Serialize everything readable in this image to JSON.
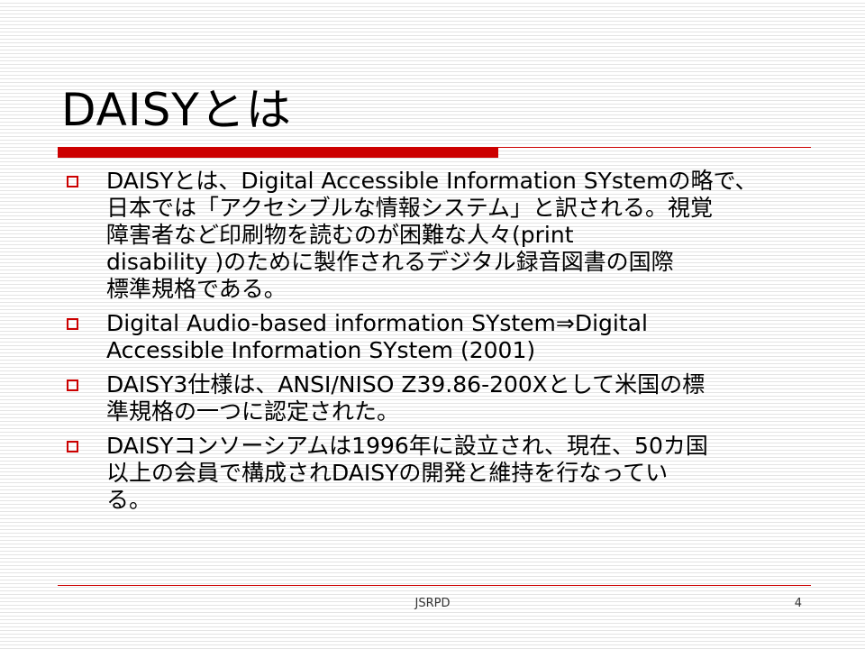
{
  "slide": {
    "title": "DAISYとは",
    "bullets": [
      {
        "text": "DAISYとは、Digital Accessible Information SYstemの略で、\n日本では「アクセシブルな情報システム」と訳される。視覚\n障害者など印刷物を読むのが困難な人々(print\ndisability )のために製作されるデジタル録音図書の国際\n標準規格である。"
      },
      {
        "text": "Digital Audio-based information SYstem⇒Digital\nAccessible Information SYstem (2001)"
      },
      {
        "text": "DAISY3仕様は、ANSI/NISO Z39.86-200Xとして米国の標\n準規格の一つに認定された。"
      },
      {
        "text": "DAISYコンソーシアムは1996年に設立され、現在、50カ国\n以上の会員で構成されDAISYの開発と維持を行なってい\nる。"
      }
    ],
    "footer": {
      "center": "JSRPD",
      "page_number": "4"
    },
    "colors": {
      "accent": "#cc0000",
      "text": "#000000",
      "background_stripe": "#e4e4e4"
    },
    "icons": {
      "bullet": "hollow-square-bullet-icon"
    }
  }
}
